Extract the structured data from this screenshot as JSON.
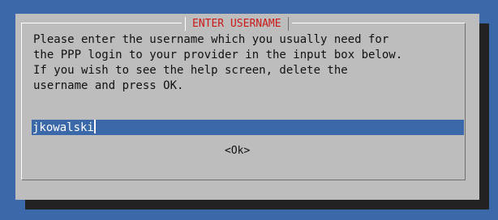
{
  "dialog": {
    "title": "ENTER USERNAME",
    "message": "Please enter the username which you usually need for\nthe PPP login to your provider in the input box below.\nIf you wish to see the help screen, delete the\nusername and press OK.",
    "input_value": "jkowalski",
    "ok_label": "<Ok>"
  },
  "colors": {
    "screen_background": "#3a68a8",
    "dialog_background": "#bdbdbd",
    "title_text": "#cc1a1a",
    "input_background": "#3a68a8",
    "shadow": "#222222"
  }
}
